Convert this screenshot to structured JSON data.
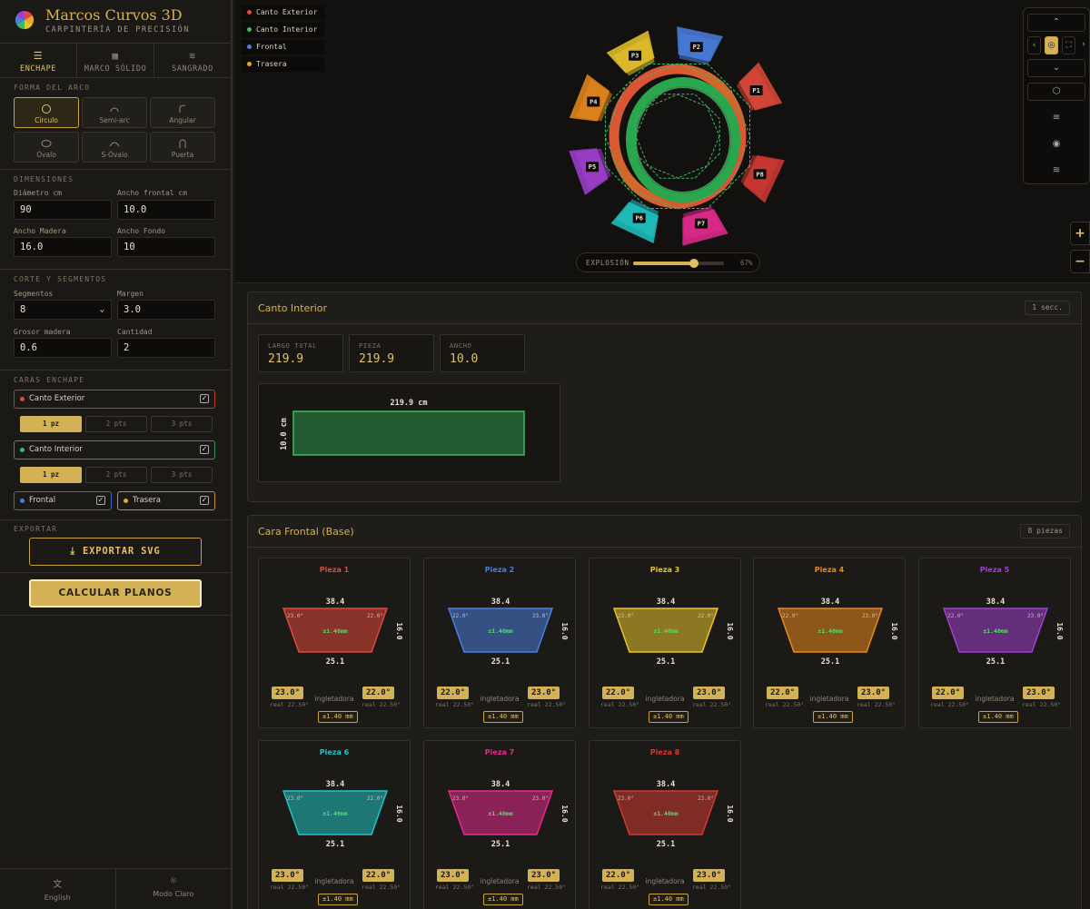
{
  "brand": {
    "title": "Marcos Curvos 3D",
    "subtitle": "CARPINTERÍA DE PRECISIÓN"
  },
  "modes": [
    {
      "label": "ENCHAPE",
      "icon": "layers-icon",
      "active": true
    },
    {
      "label": "MARCO SÓLIDO",
      "icon": "grid-icon",
      "active": false
    },
    {
      "label": "SANGRADO",
      "icon": "lines-icon",
      "active": false
    }
  ],
  "arch": {
    "title": "FORMA DEL ARCO",
    "shapes": [
      {
        "label": "Círculo",
        "icon": "circle-icon",
        "active": true
      },
      {
        "label": "Semi-arc",
        "icon": "semi-arc-icon",
        "active": false
      },
      {
        "label": "Angular",
        "icon": "angular-icon",
        "active": false
      },
      {
        "label": "Óvalo",
        "icon": "oval-icon",
        "active": false
      },
      {
        "label": "S-Óvalo",
        "icon": "s-oval-icon",
        "active": false
      },
      {
        "label": "Puerta",
        "icon": "door-icon",
        "active": false
      }
    ]
  },
  "dimensions": {
    "title": "DIMENSIONES",
    "diameter_label": "Diámetro cm",
    "diameter": "90",
    "front_width_label": "Ancho frontal cm",
    "front_width": "10.0",
    "wood_width_label": "Ancho Madera",
    "wood_width": "16.0",
    "depth_width_label": "Ancho Fondo",
    "depth_width": "10"
  },
  "cut": {
    "title": "CORTE Y SEGMENTOS",
    "segments_label": "Segmentos",
    "segments": "8",
    "margin_label": "Margen",
    "margin": "3.0",
    "thickness_label": "Grosor madera",
    "thickness": "0.6",
    "quantity_label": "Cantidad",
    "quantity": "2"
  },
  "faces": {
    "title": "CARAS ENCHAPE",
    "outer": {
      "label": "Canto Exterior",
      "checked": true,
      "color": "#e0493a"
    },
    "outer_opts": [
      "1 pz",
      "2 pts",
      "3 pts"
    ],
    "inner": {
      "label": "Canto Interior",
      "checked": true,
      "color": "#3dbb62"
    },
    "inner_opts": [
      "1 pz",
      "2 pts",
      "3 pts"
    ],
    "front": {
      "label": "Frontal",
      "checked": true,
      "color": "#4a7fe0"
    },
    "back": {
      "label": "Trasera",
      "checked": true,
      "color": "#e9a82d"
    }
  },
  "export": {
    "title": "EXPORTAR",
    "svg_label": "EXPORTAR SVG",
    "calc_label": "CALCULAR PLANOS"
  },
  "footer": {
    "language": "English",
    "theme": "Modo Claro"
  },
  "legend": [
    {
      "label": "Canto Exterior",
      "color": "#e0493a"
    },
    {
      "label": "Canto Interior",
      "color": "#3dbb62"
    },
    {
      "label": "Frontal",
      "color": "#4a7fe0"
    },
    {
      "label": "Trasera",
      "color": "#e9a82d"
    }
  ],
  "scene_labels": [
    "P1",
    "P2",
    "P3",
    "P4",
    "P5",
    "P6",
    "P7",
    "P8"
  ],
  "explosion": {
    "label": "EXPLOSIÓN",
    "value_text": "67%",
    "value": 0.67
  },
  "inner_panel": {
    "title": "Canto Interior",
    "badge": "1 secc.",
    "stats": [
      {
        "label": "LARGO TOTAL",
        "value": "219.9"
      },
      {
        "label": "PIEZA",
        "value": "219.9"
      },
      {
        "label": "ANCHO",
        "value": "10.0"
      }
    ],
    "strip_length": "219.9 cm",
    "strip_width": "10.0 cm"
  },
  "front_panel": {
    "title": "Cara Frontal (Base)",
    "badge": "8 piezas",
    "pieces": [
      {
        "name": "Pieza 1",
        "color": "#e0493a",
        "top": "38.4",
        "bottom": "25.1",
        "height": "16.0",
        "left_angle": "23.0°",
        "right_angle": "22.0°",
        "tol": "±1.40mm",
        "left_box": "23.0°",
        "right_box": "22.0°",
        "left_real": "real 22.50°",
        "right_real": "real 22.50°",
        "tol_box": "±1.40 mm"
      },
      {
        "name": "Pieza 2",
        "color": "#4a7fe0",
        "top": "38.4",
        "bottom": "25.1",
        "height": "16.0",
        "left_angle": "22.0°",
        "right_angle": "23.0°",
        "tol": "±1.40mm",
        "left_box": "22.0°",
        "right_box": "23.0°",
        "left_real": "real 22.50°",
        "right_real": "real 22.50°",
        "tol_box": "±1.40 mm"
      },
      {
        "name": "Pieza 3",
        "color": "#e9c42d",
        "top": "38.4",
        "bottom": "25.1",
        "height": "16.0",
        "left_angle": "23.0°",
        "right_angle": "22.0°",
        "tol": "±1.40mm",
        "left_box": "22.0°",
        "right_box": "23.0°",
        "left_real": "real 22.50°",
        "right_real": "real 22.50°",
        "tol_box": "±1.40 mm"
      },
      {
        "name": "Pieza 4",
        "color": "#e98a1d",
        "top": "38.4",
        "bottom": "25.1",
        "height": "16.0",
        "left_angle": "22.0°",
        "right_angle": "23.0°",
        "tol": "±1.40mm",
        "left_box": "22.0°",
        "right_box": "23.0°",
        "left_real": "real 22.50°",
        "right_real": "real 22.50°",
        "tol_box": "±1.40 mm"
      },
      {
        "name": "Pieza 5",
        "color": "#a23fd0",
        "top": "38.4",
        "bottom": "25.1",
        "height": "16.0",
        "left_angle": "22.0°",
        "right_angle": "23.0°",
        "tol": "±1.40mm",
        "left_box": "22.0°",
        "right_box": "23.0°",
        "left_real": "real 22.50°",
        "right_real": "real 22.50°",
        "tol_box": "±1.40 mm"
      },
      {
        "name": "Pieza 6",
        "color": "#20c4c4",
        "top": "38.4",
        "bottom": "25.1",
        "height": "16.0",
        "left_angle": "23.0°",
        "right_angle": "22.0°",
        "tol": "±1.40mm",
        "left_box": "23.0°",
        "right_box": "22.0°",
        "left_real": "real 22.50°",
        "right_real": "real 22.50°",
        "tol_box": "±1.40 mm"
      },
      {
        "name": "Pieza 7",
        "color": "#e52a8f",
        "top": "38.4",
        "bottom": "25.1",
        "height": "16.0",
        "left_angle": "23.0°",
        "right_angle": "23.0°",
        "tol": "±1.40mm",
        "left_box": "23.0°",
        "right_box": "23.0°",
        "left_real": "real 22.50°",
        "right_real": "real 22.50°",
        "tol_box": "±1.40 mm"
      },
      {
        "name": "Pieza 8",
        "color": "#d23a34",
        "top": "38.4",
        "bottom": "25.1",
        "height": "16.0",
        "left_angle": "23.0°",
        "right_angle": "23.0°",
        "tol": "±1.40mm",
        "left_box": "22.0°",
        "right_box": "23.0°",
        "left_real": "real 22.50°",
        "right_real": "real 22.50°",
        "tol_box": "±1.40 mm"
      }
    ],
    "ingl_label": "ingletadora"
  }
}
